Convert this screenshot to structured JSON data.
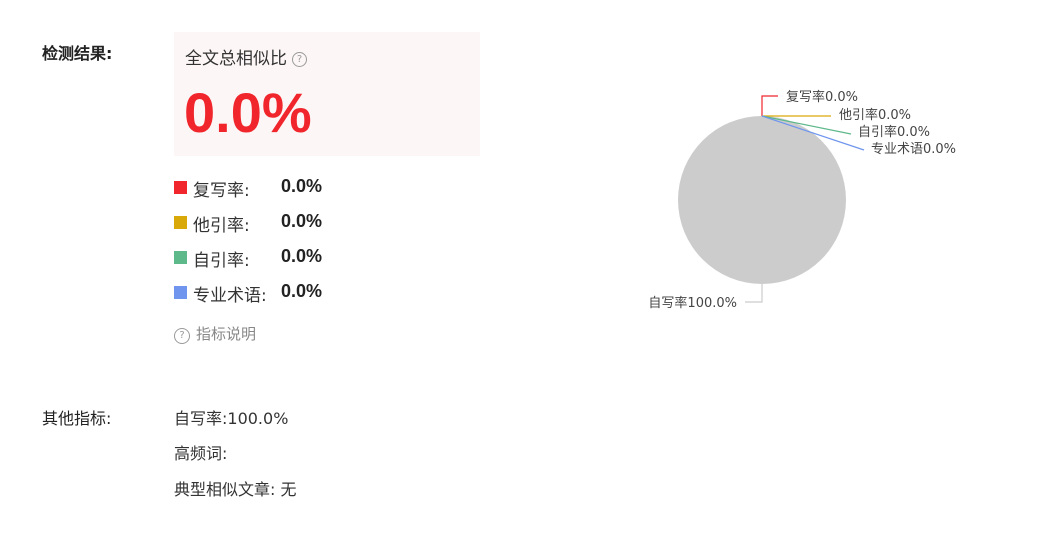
{
  "detection": {
    "section_label": "检测结果:",
    "summary": {
      "title": "全文总相似比",
      "help_glyph": "?",
      "percent": "0.0%"
    },
    "metrics": [
      {
        "label": "复写率:",
        "value": "0.0%",
        "color": "#f0262c"
      },
      {
        "label": "他引率:",
        "value": "0.0%",
        "color": "#d9a90a"
      },
      {
        "label": "自引率:",
        "value": "0.0%",
        "color": "#5db88a"
      },
      {
        "label": "专业术语:",
        "value": "0.0%",
        "color": "#6f95ee"
      }
    ],
    "indicator_help": {
      "glyph": "?",
      "label": "指标说明"
    }
  },
  "other": {
    "section_label": "其他指标:",
    "lines": [
      "自写率:100.0%",
      "高频词:",
      "典型相似文章:  无"
    ]
  },
  "chart_data": {
    "type": "pie",
    "slices": [
      {
        "label": "复写率0.0%",
        "value": 0.0,
        "color": "#f0262c"
      },
      {
        "label": "他引率0.0%",
        "value": 0.0,
        "color": "#d9a90a"
      },
      {
        "label": "自引率0.0%",
        "value": 0.0,
        "color": "#5db88a"
      },
      {
        "label": "专业术语0.0%",
        "value": 0.0,
        "color": "#6f95ee"
      },
      {
        "label": "自写率100.0%",
        "value": 100.0,
        "color": "#cccccc"
      }
    ],
    "legend": "none"
  }
}
